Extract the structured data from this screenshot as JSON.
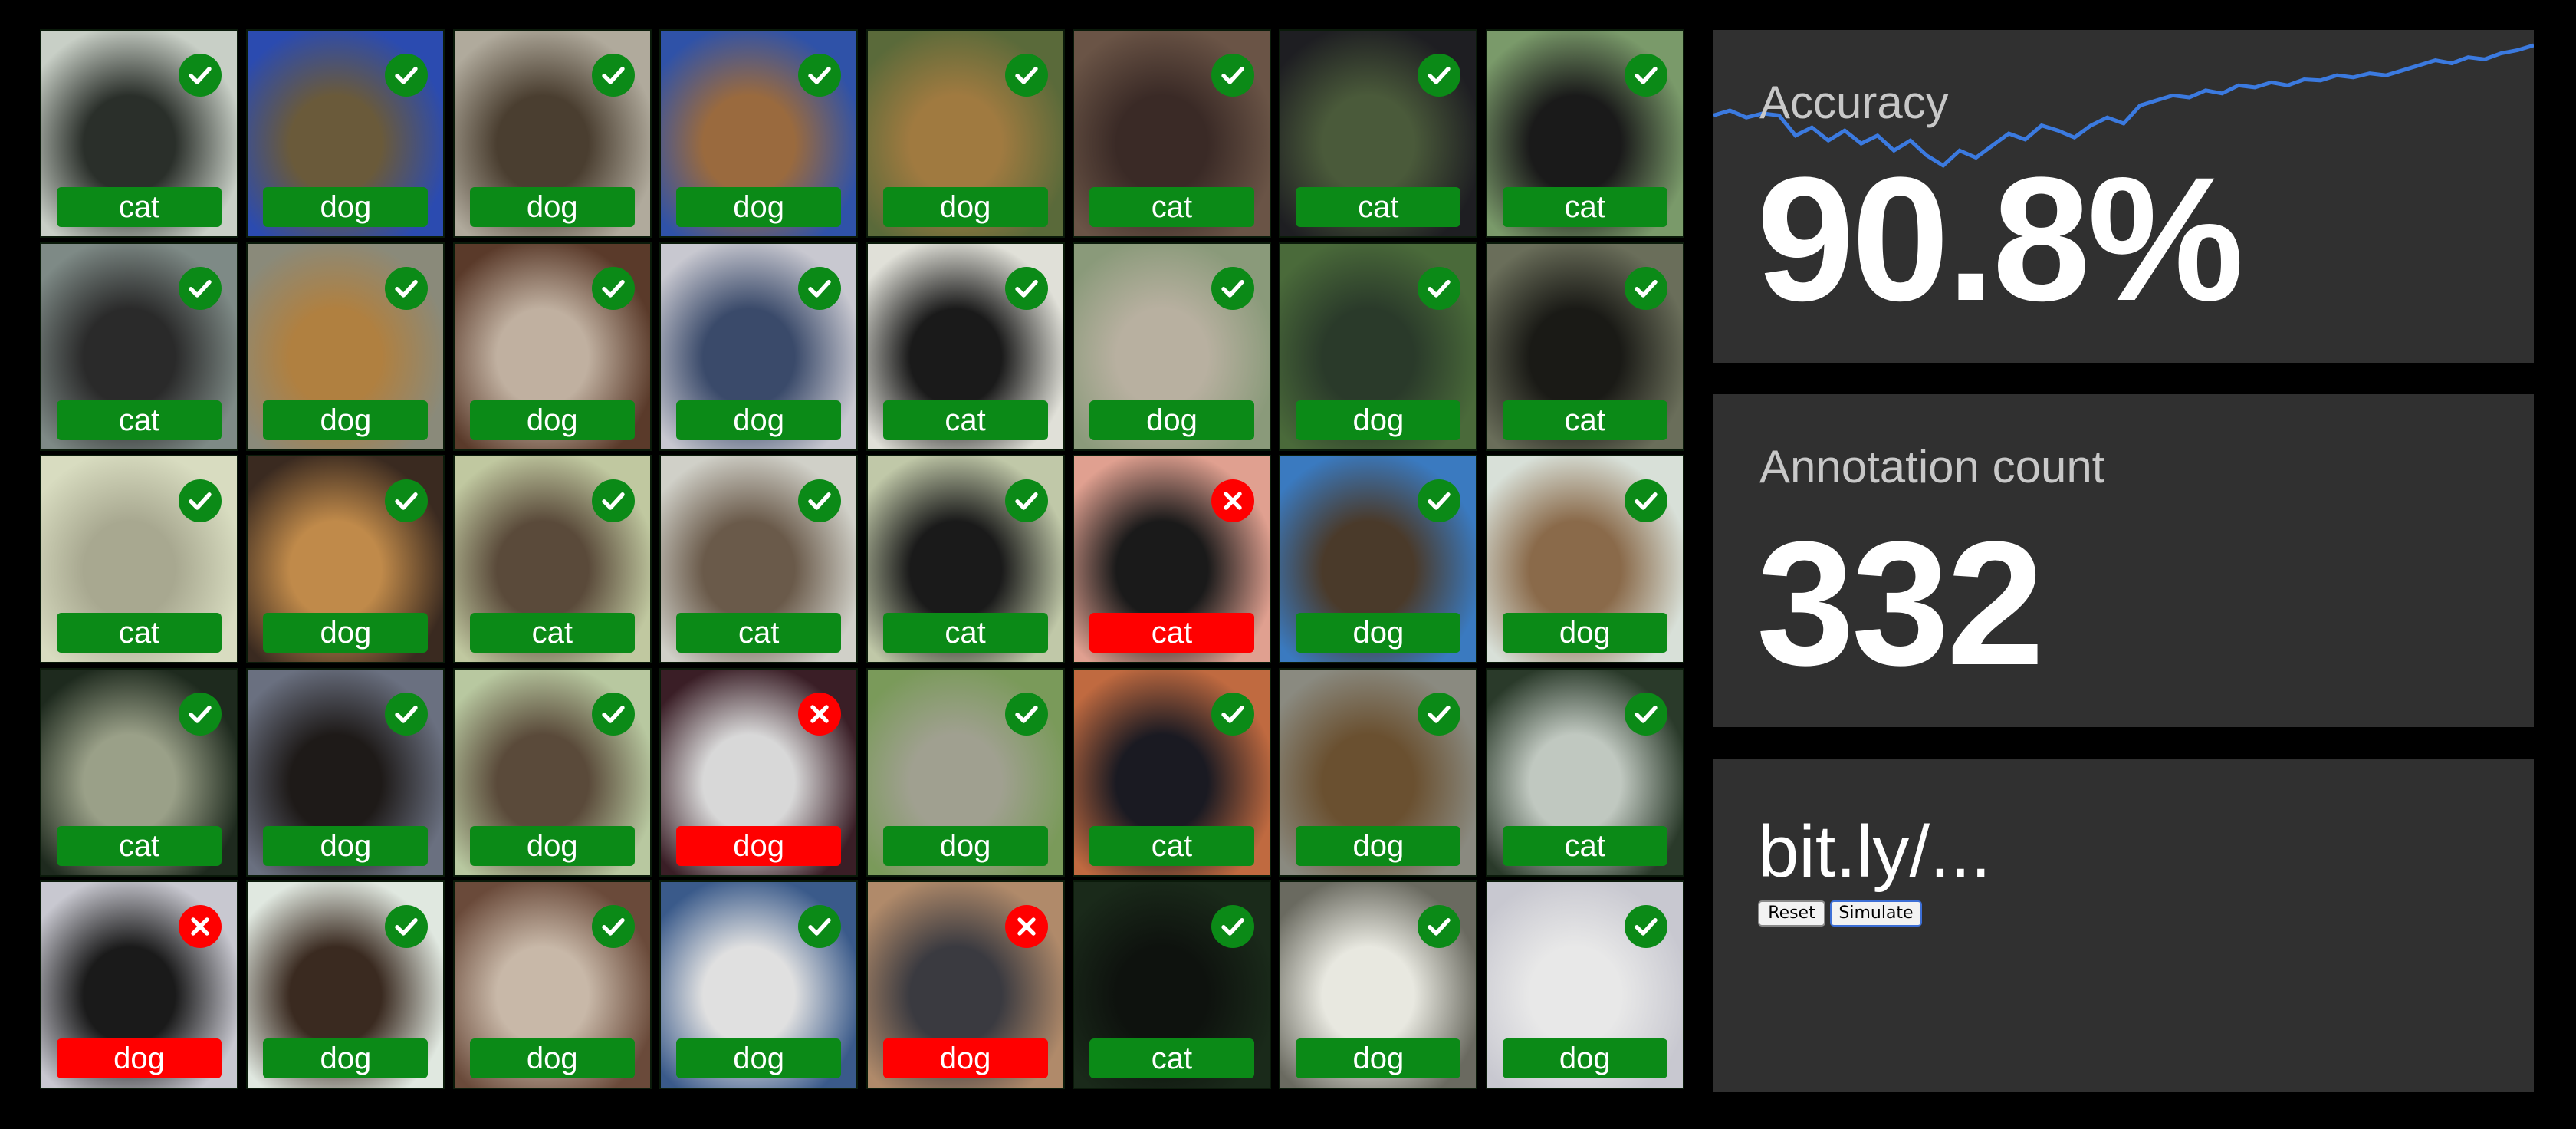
{
  "colors": {
    "correct": "#0b8a17",
    "incorrect": "#ff0000",
    "panel_bg": "#303030",
    "accuracy_line": "#3b7ae0"
  },
  "tiles": [
    {
      "label": "cat",
      "correct": true,
      "c1": "#c8cfc6",
      "c2": "#2a2f2a"
    },
    {
      "label": "dog",
      "correct": true,
      "c1": "#2b4bb0",
      "c2": "#6a5a3a"
    },
    {
      "label": "dog",
      "correct": true,
      "c1": "#b0aa9c",
      "c2": "#4a3e30"
    },
    {
      "label": "dog",
      "correct": true,
      "c1": "#2f52a8",
      "c2": "#9a6a3e"
    },
    {
      "label": "dog",
      "correct": true,
      "c1": "#5a6a3a",
      "c2": "#a07a40"
    },
    {
      "label": "cat",
      "correct": true,
      "c1": "#6a5446",
      "c2": "#3a2a26"
    },
    {
      "label": "cat",
      "correct": true,
      "c1": "#1e1e22",
      "c2": "#4a5a3a"
    },
    {
      "label": "cat",
      "correct": true,
      "c1": "#7a9a6a",
      "c2": "#1a1a1a"
    },
    {
      "label": "cat",
      "correct": true,
      "c1": "#7e8a86",
      "c2": "#2a2a2a"
    },
    {
      "label": "dog",
      "correct": true,
      "c1": "#8a8a7a",
      "c2": "#b08040"
    },
    {
      "label": "dog",
      "correct": true,
      "c1": "#5a3a2a",
      "c2": "#c0b0a0"
    },
    {
      "label": "dog",
      "correct": true,
      "c1": "#c8c8d0",
      "c2": "#3a4a6a"
    },
    {
      "label": "cat",
      "correct": true,
      "c1": "#e0e0d8",
      "c2": "#1a1a1a"
    },
    {
      "label": "dog",
      "correct": true,
      "c1": "#8a9a7a",
      "c2": "#b8b0a0"
    },
    {
      "label": "dog",
      "correct": true,
      "c1": "#4a6a3a",
      "c2": "#2a3a2a"
    },
    {
      "label": "cat",
      "correct": true,
      "c1": "#6a6e5a",
      "c2": "#1a1a16"
    },
    {
      "label": "cat",
      "correct": true,
      "c1": "#d8dcc0",
      "c2": "#a8a890"
    },
    {
      "label": "dog",
      "correct": true,
      "c1": "#3a2a20",
      "c2": "#c08a4a"
    },
    {
      "label": "cat",
      "correct": true,
      "c1": "#c0c8a0",
      "c2": "#5a4a3a"
    },
    {
      "label": "cat",
      "correct": true,
      "c1": "#d0d0c8",
      "c2": "#6a5a4a"
    },
    {
      "label": "cat",
      "correct": true,
      "c1": "#c0c8a8",
      "c2": "#1a1a1a"
    },
    {
      "label": "cat",
      "correct": false,
      "c1": "#e0a090",
      "c2": "#1a1a1a"
    },
    {
      "label": "dog",
      "correct": true,
      "c1": "#3a7ac0",
      "c2": "#4a3a2a"
    },
    {
      "label": "dog",
      "correct": true,
      "c1": "#d8e0d8",
      "c2": "#8a6a4a"
    },
    {
      "label": "cat",
      "correct": true,
      "c1": "#1e2a1e",
      "c2": "#9aa088"
    },
    {
      "label": "dog",
      "correct": true,
      "c1": "#6a7080",
      "c2": "#1e1a18"
    },
    {
      "label": "dog",
      "correct": true,
      "c1": "#b8c8a0",
      "c2": "#5a4a3a"
    },
    {
      "label": "dog",
      "correct": false,
      "c1": "#3a1e26",
      "c2": "#d8d8d8"
    },
    {
      "label": "dog",
      "correct": true,
      "c1": "#7a9a5a",
      "c2": "#a0a090"
    },
    {
      "label": "cat",
      "correct": true,
      "c1": "#c06a40",
      "c2": "#1a1a22"
    },
    {
      "label": "dog",
      "correct": true,
      "c1": "#8a8a80",
      "c2": "#6a5030"
    },
    {
      "label": "cat",
      "correct": true,
      "c1": "#2a3a2a",
      "c2": "#c0c8c0"
    },
    {
      "label": "dog",
      "correct": false,
      "c1": "#c8c8d0",
      "c2": "#1a1a1a"
    },
    {
      "label": "dog",
      "correct": true,
      "c1": "#e0e8e0",
      "c2": "#3a2a20"
    },
    {
      "label": "dog",
      "correct": true,
      "c1": "#6a4a3a",
      "c2": "#c8b8a8"
    },
    {
      "label": "dog",
      "correct": true,
      "c1": "#3a5a8a",
      "c2": "#e0e0e0"
    },
    {
      "label": "dog",
      "correct": false,
      "c1": "#b08a6a",
      "c2": "#3a3a40"
    },
    {
      "label": "cat",
      "correct": true,
      "c1": "#1a2a1a",
      "c2": "#0e120e"
    },
    {
      "label": "dog",
      "correct": true,
      "c1": "#6a6a60",
      "c2": "#e8e8e0"
    },
    {
      "label": "dog",
      "correct": true,
      "c1": "#c8c8d0",
      "c2": "#e8e8e8"
    }
  ],
  "accuracy": {
    "title": "Accuracy",
    "value": "90.8%",
    "trend": [
      0.86,
      0.865,
      0.858,
      0.862,
      0.86,
      0.84,
      0.848,
      0.835,
      0.845,
      0.832,
      0.84,
      0.825,
      0.835,
      0.82,
      0.81,
      0.825,
      0.818,
      0.83,
      0.842,
      0.836,
      0.85,
      0.845,
      0.838,
      0.85,
      0.858,
      0.852,
      0.87,
      0.875,
      0.88,
      0.878,
      0.885,
      0.882,
      0.89,
      0.888,
      0.893,
      0.89,
      0.896,
      0.895,
      0.9,
      0.898,
      0.902,
      0.9,
      0.905,
      0.91,
      0.915,
      0.912,
      0.918,
      0.916,
      0.922,
      0.925,
      0.93
    ]
  },
  "annotation": {
    "title": "Annotation count",
    "value": "332"
  },
  "link": {
    "text": "bit.ly/...",
    "reset_label": "Reset",
    "simulate_label": "Simulate"
  }
}
